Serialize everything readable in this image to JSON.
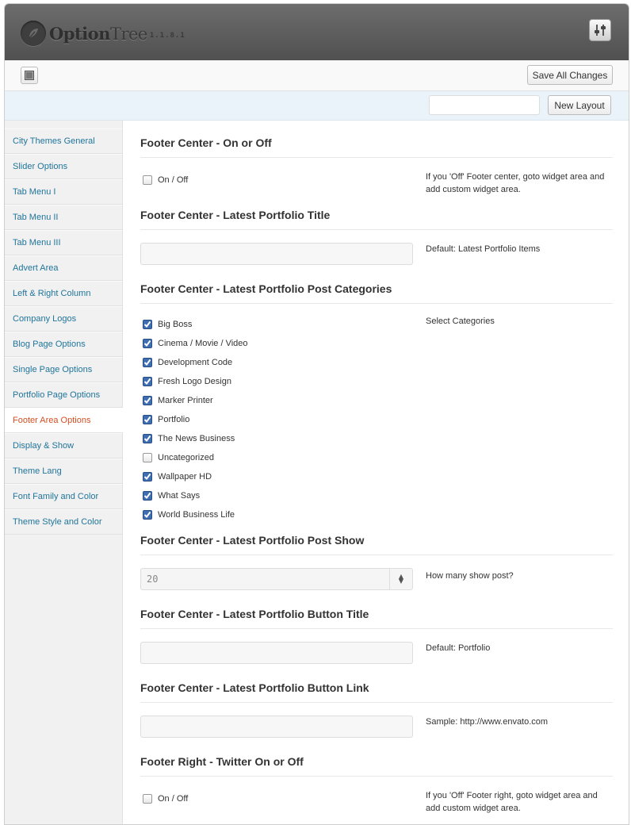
{
  "app": {
    "name_bold": "Option",
    "name_light": "Tree",
    "version": "1.1.8.1"
  },
  "toolbar": {
    "save_label": "Save All Changes",
    "new_layout_label": "New Layout",
    "layout_input_value": ""
  },
  "sidebar": {
    "items": [
      {
        "label": "City Themes General"
      },
      {
        "label": "Slider Options"
      },
      {
        "label": "Tab Menu I"
      },
      {
        "label": "Tab Menu II"
      },
      {
        "label": "Tab Menu III"
      },
      {
        "label": "Advert Area"
      },
      {
        "label": "Left & Right Column"
      },
      {
        "label": "Company Logos"
      },
      {
        "label": "Blog Page Options"
      },
      {
        "label": "Single Page Options"
      },
      {
        "label": "Portfolio Page Options"
      },
      {
        "label": "Footer Area Options"
      },
      {
        "label": "Display & Show"
      },
      {
        "label": "Theme Lang"
      },
      {
        "label": "Font Family and Color"
      },
      {
        "label": "Theme Style and Color"
      }
    ],
    "active": "Footer Area Options"
  },
  "sections": {
    "footer_center_onoff": {
      "title": "Footer Center - On or Off",
      "checkbox_label": "On / Off",
      "checked": false,
      "desc": "If you 'Off' Footer center, goto widget area and add custom widget area."
    },
    "portfolio_title": {
      "title": "Footer Center - Latest Portfolio Title",
      "value": "",
      "desc": "Default: Latest Portfolio Items"
    },
    "portfolio_categories": {
      "title": "Footer Center - Latest Portfolio Post Categories",
      "desc": "Select Categories",
      "items": [
        {
          "label": "Big Boss",
          "checked": true
        },
        {
          "label": "Cinema / Movie / Video",
          "checked": true
        },
        {
          "label": "Development Code",
          "checked": true
        },
        {
          "label": "Fresh Logo Design",
          "checked": true
        },
        {
          "label": "Marker Printer",
          "checked": true
        },
        {
          "label": "Portfolio",
          "checked": true
        },
        {
          "label": "The News Business",
          "checked": true
        },
        {
          "label": "Uncategorized",
          "checked": false
        },
        {
          "label": "Wallpaper HD",
          "checked": true
        },
        {
          "label": "What Says",
          "checked": true
        },
        {
          "label": "World Business Life",
          "checked": true
        }
      ]
    },
    "portfolio_show": {
      "title": "Footer Center - Latest Portfolio Post Show",
      "value": "20",
      "desc": "How many show post?"
    },
    "button_title": {
      "title": "Footer Center - Latest Portfolio Button Title",
      "value": "",
      "desc": "Default: Portfolio"
    },
    "button_link": {
      "title": "Footer Center - Latest Portfolio Button Link",
      "value": "",
      "desc": "Sample: http://www.envato.com"
    },
    "twitter_onoff": {
      "title": "Footer Right - Twitter On or Off",
      "checkbox_label": "On / Off",
      "checked": false,
      "desc": "If you 'Off' Footer right, goto widget area and add custom widget area."
    }
  },
  "colors": {
    "link": "#21759b",
    "active": "#d54e21",
    "checkbox": "#3d6fb0"
  }
}
